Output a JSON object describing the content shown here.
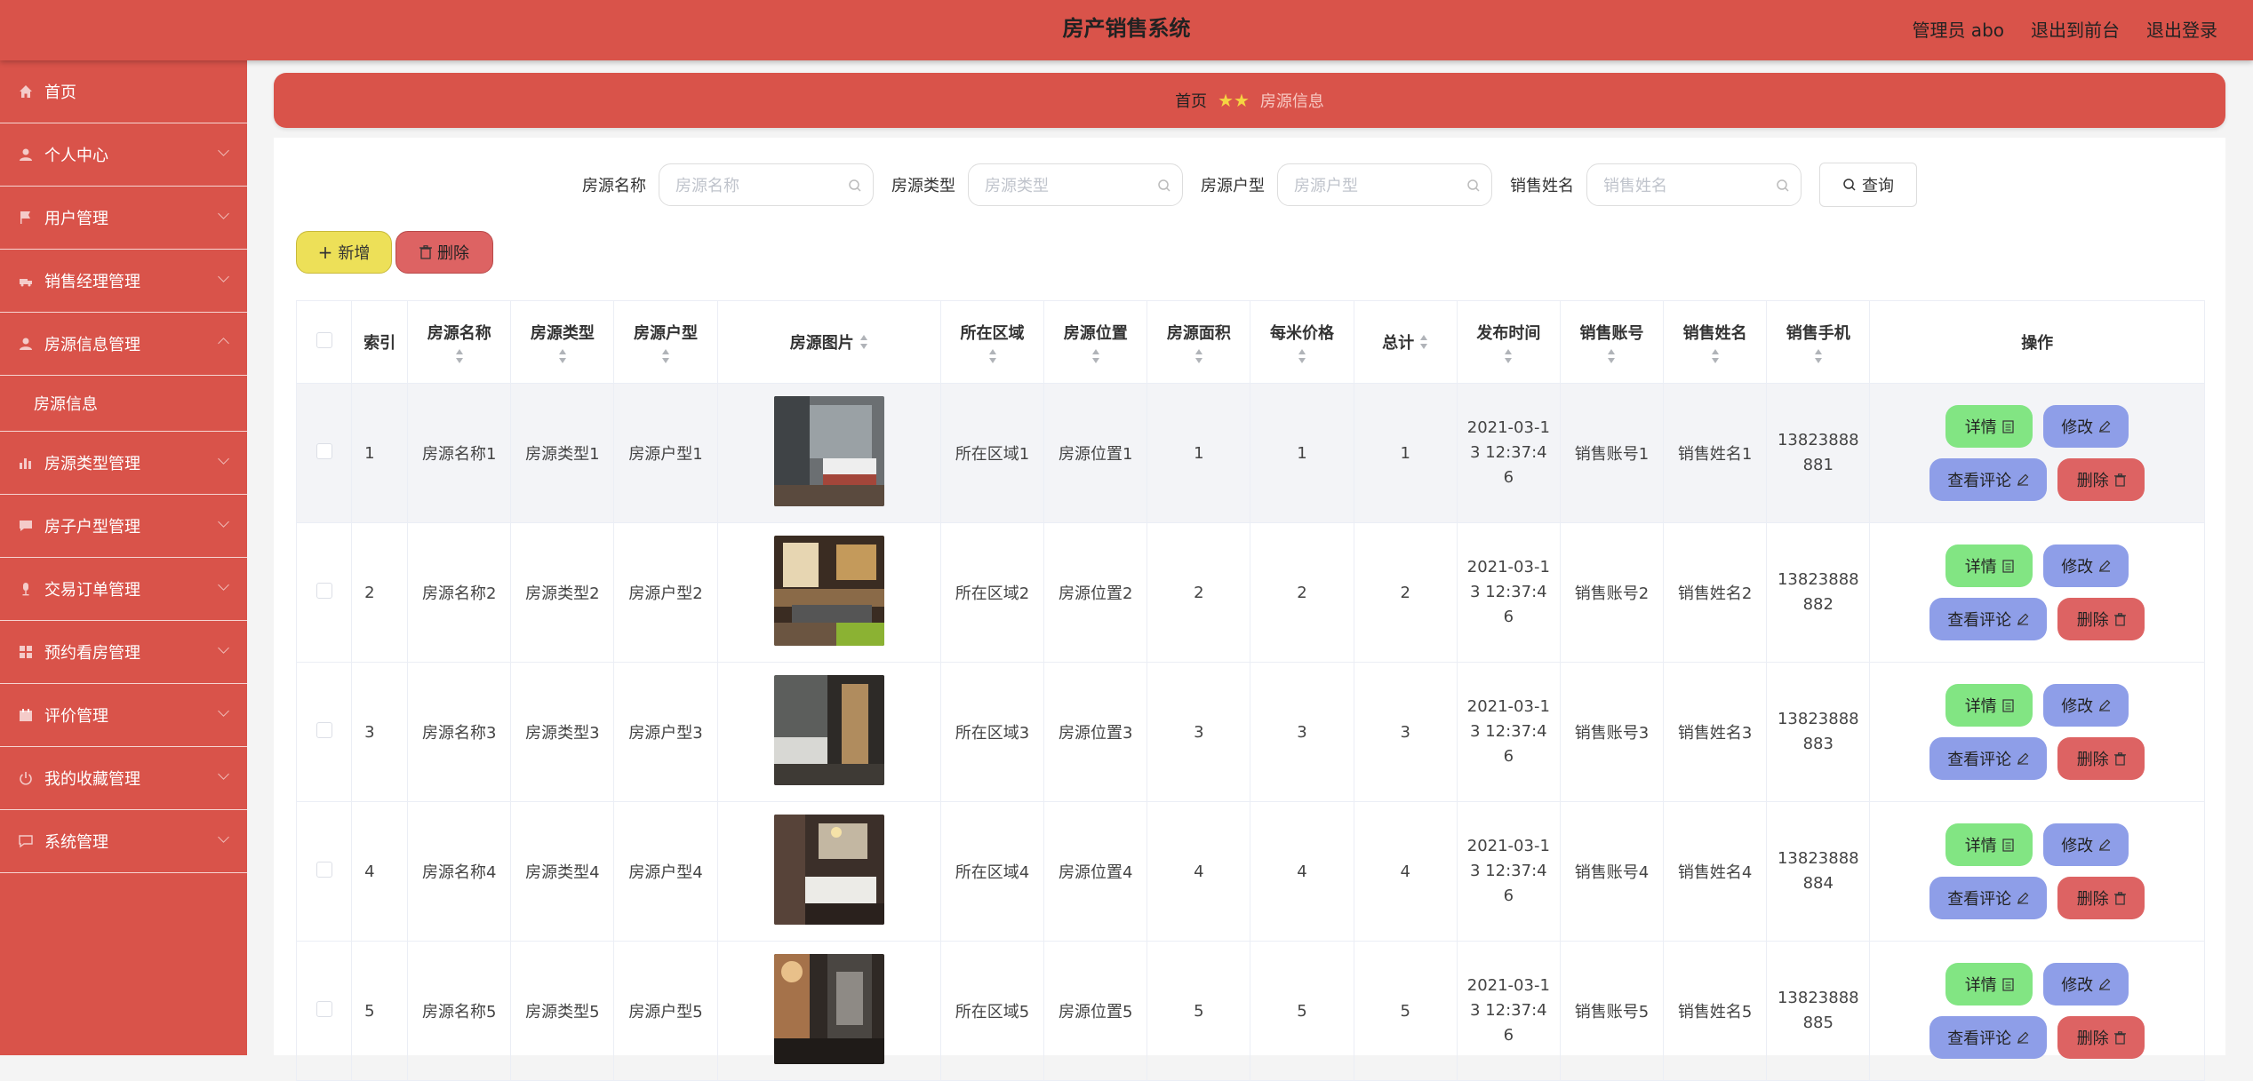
{
  "header": {
    "title": "房产销售系统",
    "admin_label": "管理员 abo",
    "front_label": "退出到前台",
    "logout_label": "退出登录"
  },
  "sidebar": {
    "items": [
      {
        "label": "首页",
        "icon": "home-icon"
      },
      {
        "label": "个人中心",
        "icon": "user-icon"
      },
      {
        "label": "用户管理",
        "icon": "flag-icon"
      },
      {
        "label": "销售经理管理",
        "icon": "truck-icon"
      },
      {
        "label": "房源信息管理",
        "icon": "user-icon"
      },
      {
        "label": "房源信息",
        "icon": ""
      },
      {
        "label": "房源类型管理",
        "icon": "bar-chart-icon"
      },
      {
        "label": "房子户型管理",
        "icon": "comment-icon"
      },
      {
        "label": "交易订单管理",
        "icon": "microphone-icon"
      },
      {
        "label": "预约看房管理",
        "icon": "grid-icon"
      },
      {
        "label": "评价管理",
        "icon": "calendar-icon"
      },
      {
        "label": "我的收藏管理",
        "icon": "power-icon"
      },
      {
        "label": "系统管理",
        "icon": "message-icon"
      }
    ]
  },
  "breadcrumb": {
    "home": "首页",
    "stars": "★★",
    "current": "房源信息"
  },
  "search": {
    "name_label": "房源名称",
    "name_placeholder": "房源名称",
    "type_label": "房源类型",
    "type_placeholder": "房源类型",
    "layout_label": "房源户型",
    "layout_placeholder": "房源户型",
    "seller_label": "销售姓名",
    "seller_placeholder": "销售姓名",
    "query_label": "查询"
  },
  "toolbar": {
    "add_label": "新增",
    "delete_label": "删除"
  },
  "table": {
    "headers": {
      "index": "索引",
      "name": "房源名称",
      "type": "房源类型",
      "layout": "房源户型",
      "image": "房源图片",
      "area_region": "所在区域",
      "position": "房源位置",
      "size": "房源面积",
      "price": "每米价格",
      "total": "总计",
      "time": "发布时间",
      "account": "销售账号",
      "seller": "销售姓名",
      "phone": "销售手机",
      "ops": "操作"
    },
    "rows": [
      {
        "index": "1",
        "name": "房源名称1",
        "type": "房源类型1",
        "layout": "房源户型1",
        "region": "所在区域1",
        "position": "房源位置1",
        "size": "1",
        "price": "1",
        "total": "1",
        "time": "2021-03-13 12:37:46",
        "account": "销售账号1",
        "seller": "销售姓名1",
        "phone": "13823888881"
      },
      {
        "index": "2",
        "name": "房源名称2",
        "type": "房源类型2",
        "layout": "房源户型2",
        "region": "所在区域2",
        "position": "房源位置2",
        "size": "2",
        "price": "2",
        "total": "2",
        "time": "2021-03-13 12:37:46",
        "account": "销售账号2",
        "seller": "销售姓名2",
        "phone": "13823888882"
      },
      {
        "index": "3",
        "name": "房源名称3",
        "type": "房源类型3",
        "layout": "房源户型3",
        "region": "所在区域3",
        "position": "房源位置3",
        "size": "3",
        "price": "3",
        "total": "3",
        "time": "2021-03-13 12:37:46",
        "account": "销售账号3",
        "seller": "销售姓名3",
        "phone": "13823888883"
      },
      {
        "index": "4",
        "name": "房源名称4",
        "type": "房源类型4",
        "layout": "房源户型4",
        "region": "所在区域4",
        "position": "房源位置4",
        "size": "4",
        "price": "4",
        "total": "4",
        "time": "2021-03-13 12:37:46",
        "account": "销售账号4",
        "seller": "销售姓名4",
        "phone": "13823888884"
      },
      {
        "index": "5",
        "name": "房源名称5",
        "type": "房源类型5",
        "layout": "房源户型5",
        "region": "所在区域5",
        "position": "房源位置5",
        "size": "5",
        "price": "5",
        "total": "5",
        "time": "2021-03-13 12:37:46",
        "account": "销售账号5",
        "seller": "销售姓名5",
        "phone": "13823888885"
      }
    ],
    "op_labels": {
      "detail": "详情",
      "edit": "修改",
      "review": "查看评论",
      "remove": "删除"
    }
  },
  "colors": {
    "brand": "#d9534a",
    "add_button": "#ede058",
    "delete_button": "#dd6363",
    "detail_button": "#82e583",
    "edit_button": "#8e9ee8"
  }
}
